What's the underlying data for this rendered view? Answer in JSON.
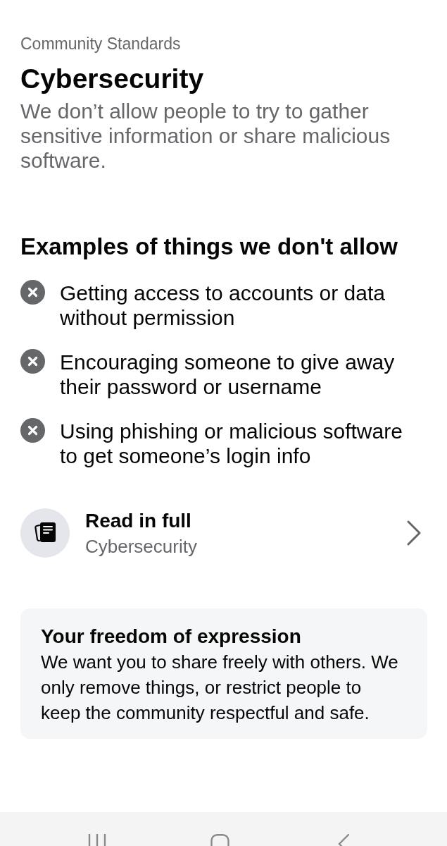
{
  "header": {
    "breadcrumb": "Community Standards",
    "title": "Cybersecurity",
    "description": "We don’t allow people to try to gather sensitive information or share malicious software."
  },
  "examples": {
    "heading": "Examples of things we don't allow",
    "items": [
      {
        "text": "Getting access to accounts or data without permission"
      },
      {
        "text": "Encouraging someone to give away their password or username"
      },
      {
        "text": "Using phishing or malicious software to get someone’s login info"
      }
    ]
  },
  "read_in_full": {
    "title": "Read in full",
    "subtitle": "Cybersecurity"
  },
  "freedom_card": {
    "title": "Your freedom of expression",
    "body": "We want you to share freely with others. We only remove things, or restrict people to keep the community respectful and safe."
  }
}
